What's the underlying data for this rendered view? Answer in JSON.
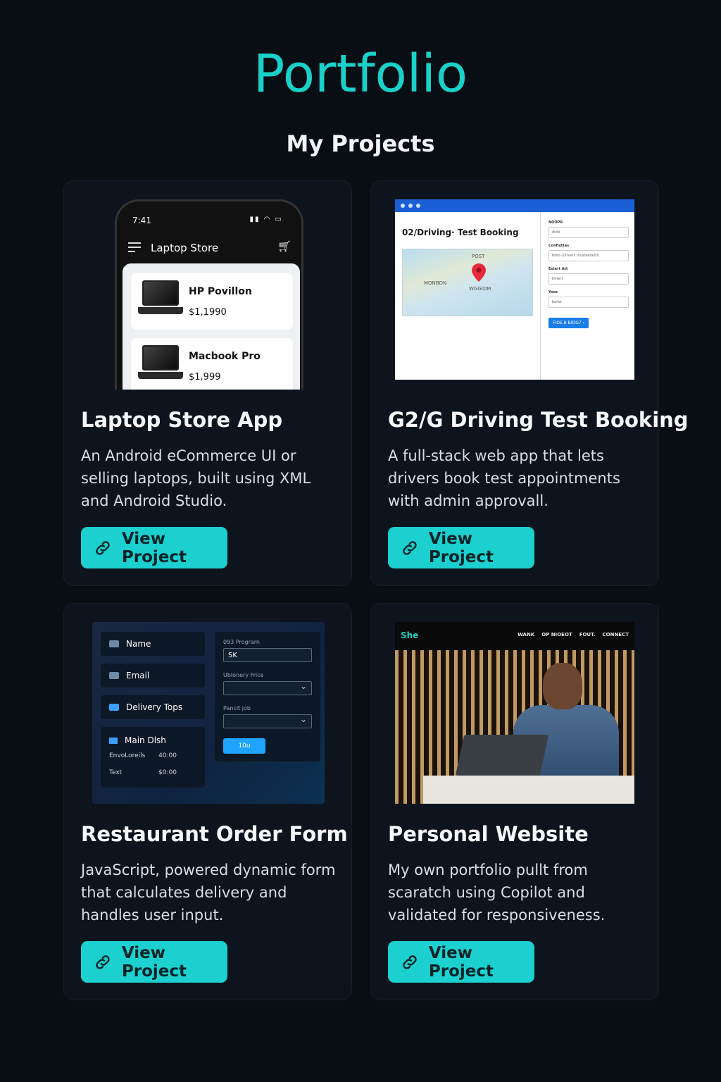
{
  "header": {
    "title": "Portfolio",
    "subtitle": "My Projects"
  },
  "projects": [
    {
      "title": "Laptop Store App",
      "description": "An Android eCommerce UI or selling laptops, built using XML and Android Studio.",
      "button": "View Project",
      "preview": {
        "time": "7:41",
        "app_title": "Laptop Store",
        "products": [
          {
            "name": "HP Povillon",
            "price": "$1,1990"
          },
          {
            "name": "Macbook Pro",
            "price": "$1,999"
          }
        ]
      }
    },
    {
      "title": "G2/G Driving Test Booking",
      "description": "A full-stack web app that lets drivers book test appointments with admin approvall.",
      "button": "View Project",
      "preview": {
        "page_title": "02/Driving· Test Booking",
        "map_labels": [
          "POST",
          "MONBDN",
          "WGGIDM"
        ],
        "form_labels": [
          "NOOPR",
          "Confiuttas",
          "Estert Att",
          "Yoos"
        ],
        "form_values": [
          "didd",
          "Nmo (Dlrvers Vlusteetaoti)",
          "Dstert",
          "boiler"
        ],
        "submit": "FIOE.B BIOG7 ›"
      }
    },
    {
      "title": "Restaurant Order Form",
      "description": "JavaScript, powered dynamic form that calculates delivery and handles user input.",
      "button": "View Project",
      "preview": {
        "fields": [
          "Name",
          "Email",
          "Delivery Tops"
        ],
        "main_dish": "Main Dlsh",
        "rows": [
          {
            "label": "EnvoLoreils",
            "value": "40:00"
          },
          {
            "label": "Text",
            "value": "$0:00"
          }
        ],
        "right_label_1": "093 Prograrn",
        "input_value": "SK",
        "right_label_2": "Ublonery Frice",
        "right_label_3": "Pancit job",
        "button": "10u"
      }
    },
    {
      "title": "Personal Website",
      "description": "My own portfolio pullt from scaratch using Copilot and validated for responsiveness.",
      "button": "View Project",
      "preview": {
        "logo": "She",
        "nav": [
          "WANK",
          "OP NIOEOT",
          "FOUT.",
          "CONNECT"
        ]
      }
    }
  ],
  "colors": {
    "accent": "#1bd0cf",
    "background": "#090d14",
    "card": "#0e141d"
  },
  "icons": {
    "button_icon": "link-icon"
  }
}
